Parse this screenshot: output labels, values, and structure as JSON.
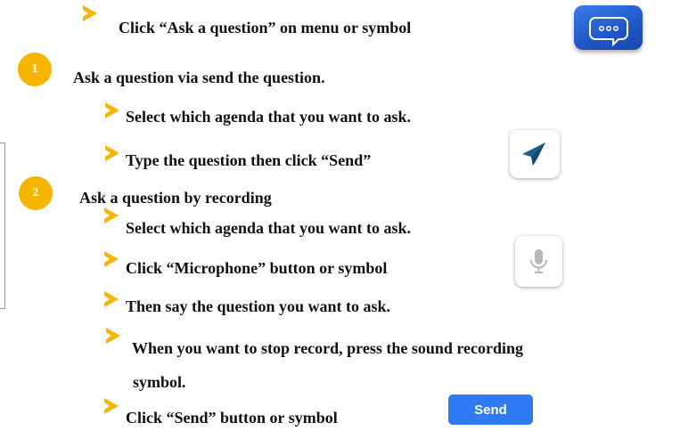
{
  "steps": {
    "intro": "Click “Ask a question” on menu or  symbol",
    "section1": {
      "number": "1",
      "title": "Ask a question via send the question.",
      "items": [
        "Select which agenda that you want to  ask.",
        "Type the question then click  “Send”"
      ]
    },
    "section2": {
      "number": "2",
      "title": "Ask a question by recording",
      "items": [
        "Select which agenda that you want to  ask.",
        "Click “Microphone” button or symbol",
        "Then say the question you want to ask.",
        "When you want to stop record, press the sound  recording",
        "symbol.",
        "Click “Send” button or symbol"
      ]
    }
  },
  "buttons": {
    "send_label": "Send"
  },
  "icons": {
    "chat": "chat-bubble-icon",
    "send": "paper-plane-icon",
    "mic": "microphone-icon",
    "bullet": "chevron-arrow-icon"
  },
  "colors": {
    "accent": "#f7b500",
    "chat_button": "#2a63d6",
    "send_button": "#2f7bf5",
    "plane": "#1f5e8c",
    "mic": "#b8b8b8"
  }
}
